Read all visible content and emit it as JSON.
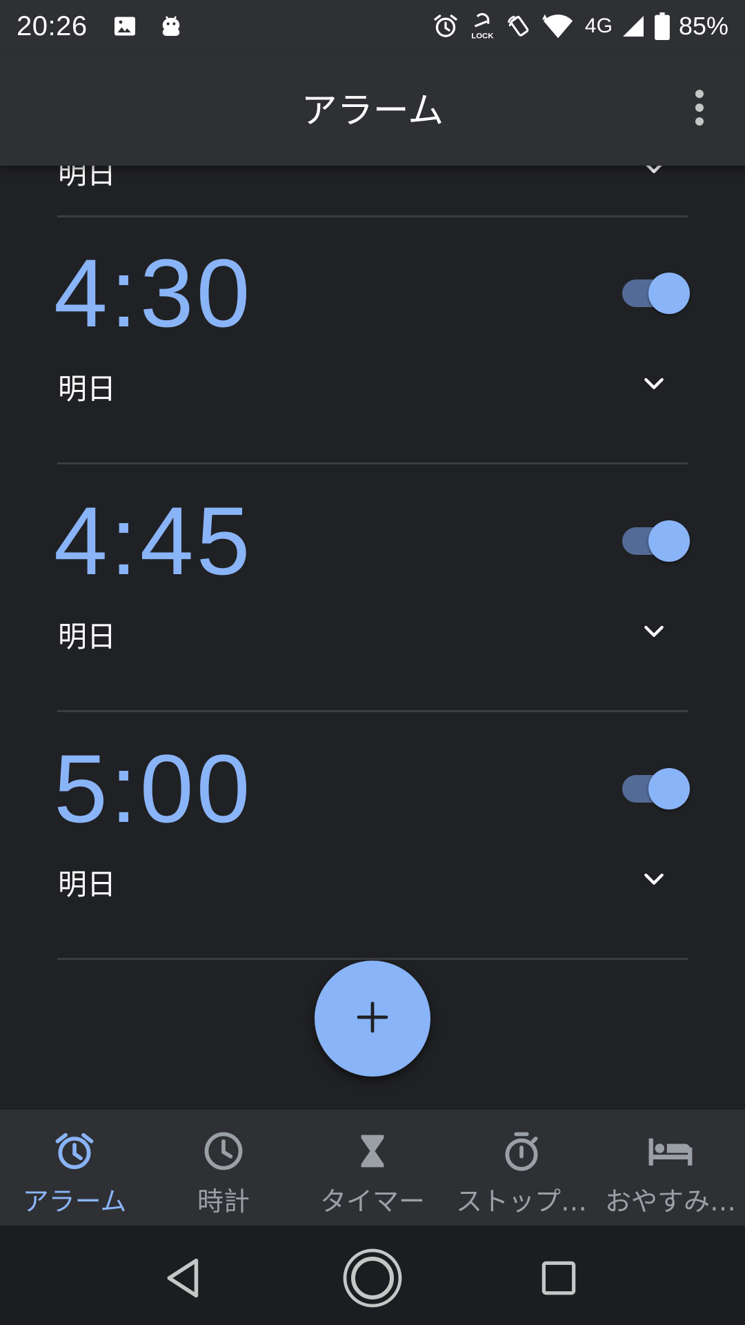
{
  "status_bar": {
    "time": "20:26",
    "network": "4G",
    "battery": "85%",
    "icons": [
      "image-icon",
      "android-bugdroid-icon",
      "alarm-icon",
      "lock-icon",
      "vibrate-icon",
      "wifi-icon",
      "signal-icon",
      "battery-icon"
    ]
  },
  "app_bar": {
    "title": "アラーム",
    "menu_icon": "more-vert-icon"
  },
  "alarms": [
    {
      "time": "",
      "day": "明日",
      "enabled": true,
      "partial": true
    },
    {
      "time": "4:30",
      "day": "明日",
      "enabled": true
    },
    {
      "time": "4:45",
      "day": "明日",
      "enabled": true
    },
    {
      "time": "5:00",
      "day": "明日",
      "enabled": true
    }
  ],
  "fab": {
    "icon": "plus-icon"
  },
  "bottom_nav": {
    "items": [
      {
        "label": "アラーム",
        "icon": "alarm-icon",
        "active": true
      },
      {
        "label": "時計",
        "icon": "clock-icon",
        "active": false
      },
      {
        "label": "タイマー",
        "icon": "hourglass-icon",
        "active": false
      },
      {
        "label": "ストップ…",
        "icon": "stopwatch-icon",
        "active": false
      },
      {
        "label": "おやすみ…",
        "icon": "bed-icon",
        "active": false
      }
    ]
  },
  "colors": {
    "accent": "#8ab4f8",
    "background": "#202124",
    "surface": "#2f3034",
    "toggle_track": "#536b96",
    "inactive": "#9aa0a6"
  }
}
